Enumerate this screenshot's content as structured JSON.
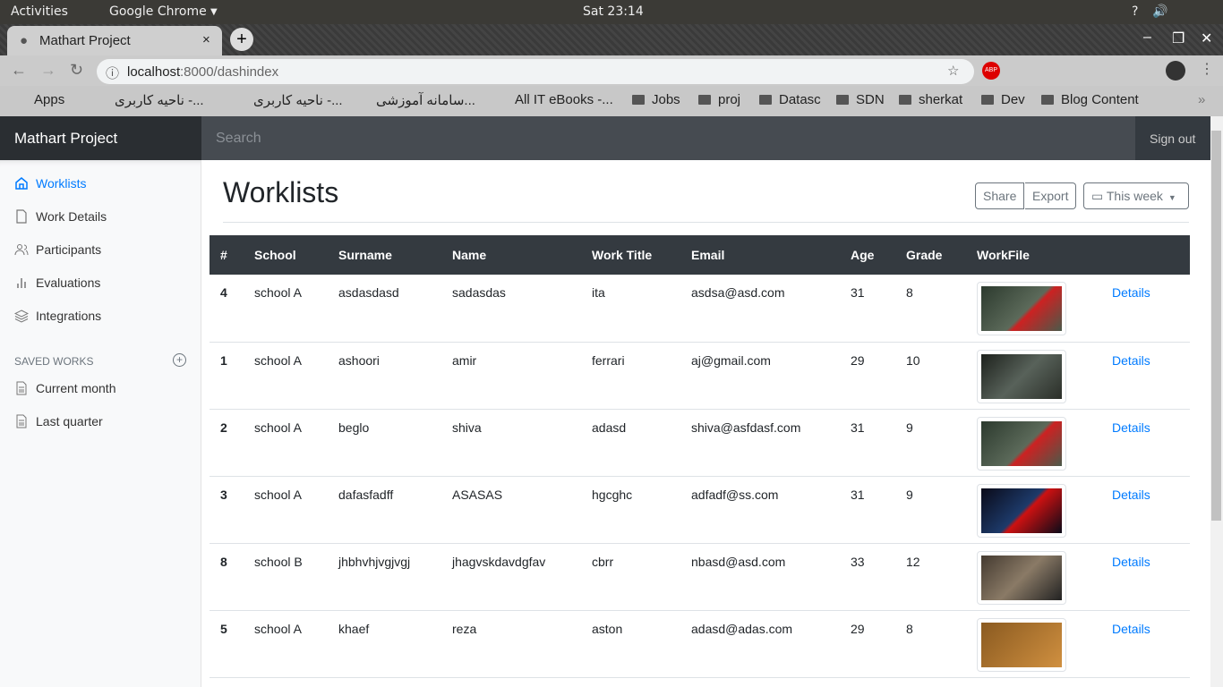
{
  "os": {
    "activities": "Activities",
    "app": "Google Chrome",
    "clock": "Sat 23:14"
  },
  "browser": {
    "tab_title": "Mathart Project",
    "url_host": "localhost",
    "url_rest": ":8000/dashindex",
    "bookmarks": [
      "Apps",
      "ناحیه کاربری -...",
      "ناحیه کاربری -...",
      "سامانه آموزشی...",
      "All IT eBooks -...",
      "Jobs",
      "proj",
      "Datasc",
      "SDN",
      "sherkat",
      "Dev",
      "Blog Content"
    ]
  },
  "navbar": {
    "brand": "Mathart Project",
    "search_placeholder": "Search",
    "signout": "Sign out"
  },
  "sidebar": {
    "items": [
      {
        "label": "Worklists",
        "icon": "home-icon",
        "active": true
      },
      {
        "label": "Work Details",
        "icon": "file-icon"
      },
      {
        "label": "Participants",
        "icon": "users-icon"
      },
      {
        "label": "Evaluations",
        "icon": "bar-chart-icon"
      },
      {
        "label": "Integrations",
        "icon": "layers-icon"
      }
    ],
    "saved_heading": "SAVED WORKS",
    "saved": [
      {
        "label": "Current month"
      },
      {
        "label": "Last quarter"
      }
    ]
  },
  "main": {
    "title": "Worklists",
    "share": "Share",
    "export": "Export",
    "range": "This week"
  },
  "table": {
    "headers": [
      "#",
      "School",
      "Surname",
      "Name",
      "Work Title",
      "Email",
      "Age",
      "Grade",
      "WorkFile",
      ""
    ],
    "rows": [
      [
        "4",
        "school A",
        "asdasdasd",
        "sadasdas",
        "ita",
        "asdsa@asd.com",
        "31",
        "8"
      ],
      [
        "1",
        "school A",
        "ashoori",
        "amir",
        "ferrari",
        "aj@gmail.com",
        "29",
        "10"
      ],
      [
        "2",
        "school A",
        "beglo",
        "shiva",
        "adasd",
        "shiva@asfdasf.com",
        "31",
        "9"
      ],
      [
        "3",
        "school A",
        "dafasfadff",
        "ASASAS",
        "hgcghc",
        "adfadf@ss.com",
        "31",
        "9"
      ],
      [
        "8",
        "school B",
        "jhbhvhjvgjvgj",
        "jhagvskdavdgfav",
        "cbrr",
        "nbasd@asd.com",
        "33",
        "12"
      ],
      [
        "5",
        "school A",
        "khaef",
        "reza",
        "aston",
        "adasd@adas.com",
        "29",
        "8"
      ]
    ],
    "details_label": "Details"
  },
  "colors": {
    "accent": "#007bff",
    "navbar": "#343a40"
  }
}
